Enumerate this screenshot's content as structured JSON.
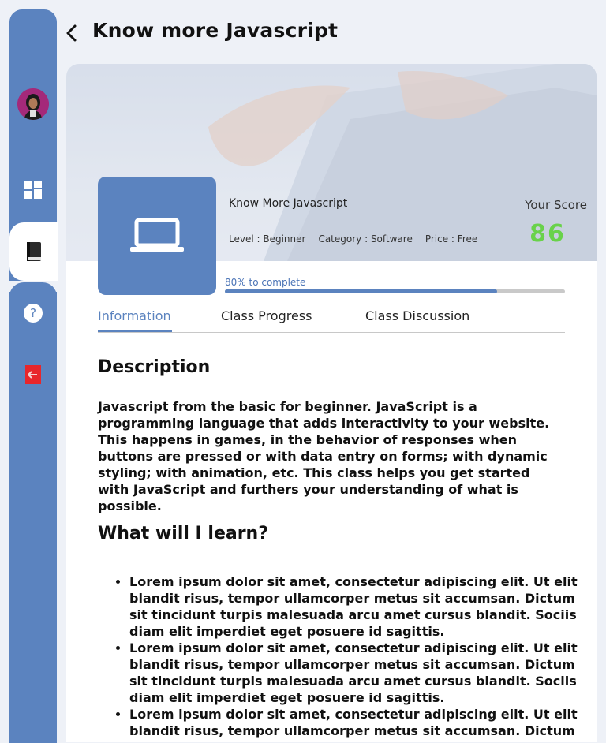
{
  "header": {
    "back_icon": "chevron-left-icon",
    "title": "Know more Javascript"
  },
  "sidebar": {
    "avatar": "user-avatar",
    "items": [
      {
        "icon": "dashboard-grid-icon",
        "active": false
      },
      {
        "icon": "book-icon",
        "active": true
      },
      {
        "icon": "help-question-icon",
        "active": false
      },
      {
        "icon": "logout-icon",
        "active": false
      }
    ]
  },
  "course": {
    "thumbnail_icon": "laptop-icon",
    "name": "Know More Javascript",
    "level": "Level : Beginner",
    "category": "Category : Software",
    "price": "Price : Free",
    "score_label": "Your Score",
    "score": "86",
    "progress_text": "80% to complete",
    "progress_fraction": 0.8
  },
  "tabs": [
    {
      "label": "Information",
      "active": true
    },
    {
      "label": "Class Progress",
      "active": false
    },
    {
      "label": "Class Discussion",
      "active": false
    }
  ],
  "content": {
    "description_heading": "Description",
    "description": "Javascript from the basic for beginner. JavaScript is a programming language that adds interactivity to your website. This happens in games, in the behavior of responses when buttons are pressed or with data entry on forms; with dynamic styling; with animation, etc. This class helps you get started with JavaScript and furthers your understanding of what is possible.",
    "learn_heading": "What will I learn?",
    "learn_items": [
      "Lorem ipsum dolor sit amet, consectetur adipiscing elit. Ut elit blandit risus, tempor ullamcorper metus sit accumsan. Dictum sit tincidunt turpis malesuada arcu amet cursus blandit. Sociis diam elit imperdiet eget posuere id sagittis.",
      "Lorem ipsum dolor sit amet, consectetur adipiscing elit. Ut elit blandit risus, tempor ullamcorper metus sit accumsan. Dictum sit tincidunt turpis malesuada arcu amet cursus blandit. Sociis diam elit imperdiet eget posuere id sagittis.",
      "Lorem ipsum dolor sit amet, consectetur adipiscing elit. Ut elit blandit risus, tempor ullamcorper metus sit accumsan. Dictum sit tincidunt turpis malesuada arcu amet cursus blandit. Sociis diam elit imperdiet eget posuere id sagittis."
    ]
  },
  "colors": {
    "accent": "#5b83bf",
    "score": "#69d24a",
    "logout": "#e8262b"
  }
}
